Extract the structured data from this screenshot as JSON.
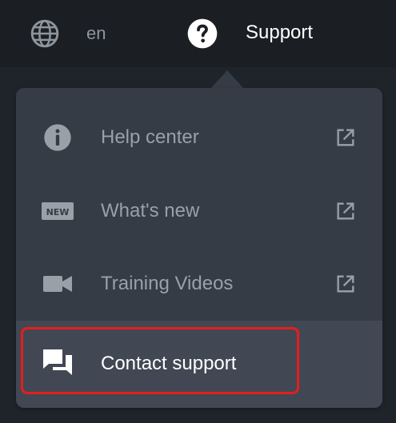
{
  "topbar": {
    "language": "en",
    "support_label": "Support"
  },
  "menu": {
    "items": [
      {
        "label": "Help center",
        "icon": "info-icon",
        "external": true
      },
      {
        "label": "What's new",
        "icon": "new-badge-icon",
        "badge_text": "NEW",
        "external": true
      },
      {
        "label": "Training Videos",
        "icon": "video-camera-icon",
        "external": true
      },
      {
        "label": "Contact support",
        "icon": "chat-bubbles-icon",
        "external": false,
        "highlighted": true
      }
    ]
  },
  "colors": {
    "topbar_bg": "#1b1f24",
    "menu_bg": "#363c45",
    "menu_hover_bg": "#414853",
    "muted_text": "#9aa0a8",
    "highlight": "#e41e1e"
  }
}
